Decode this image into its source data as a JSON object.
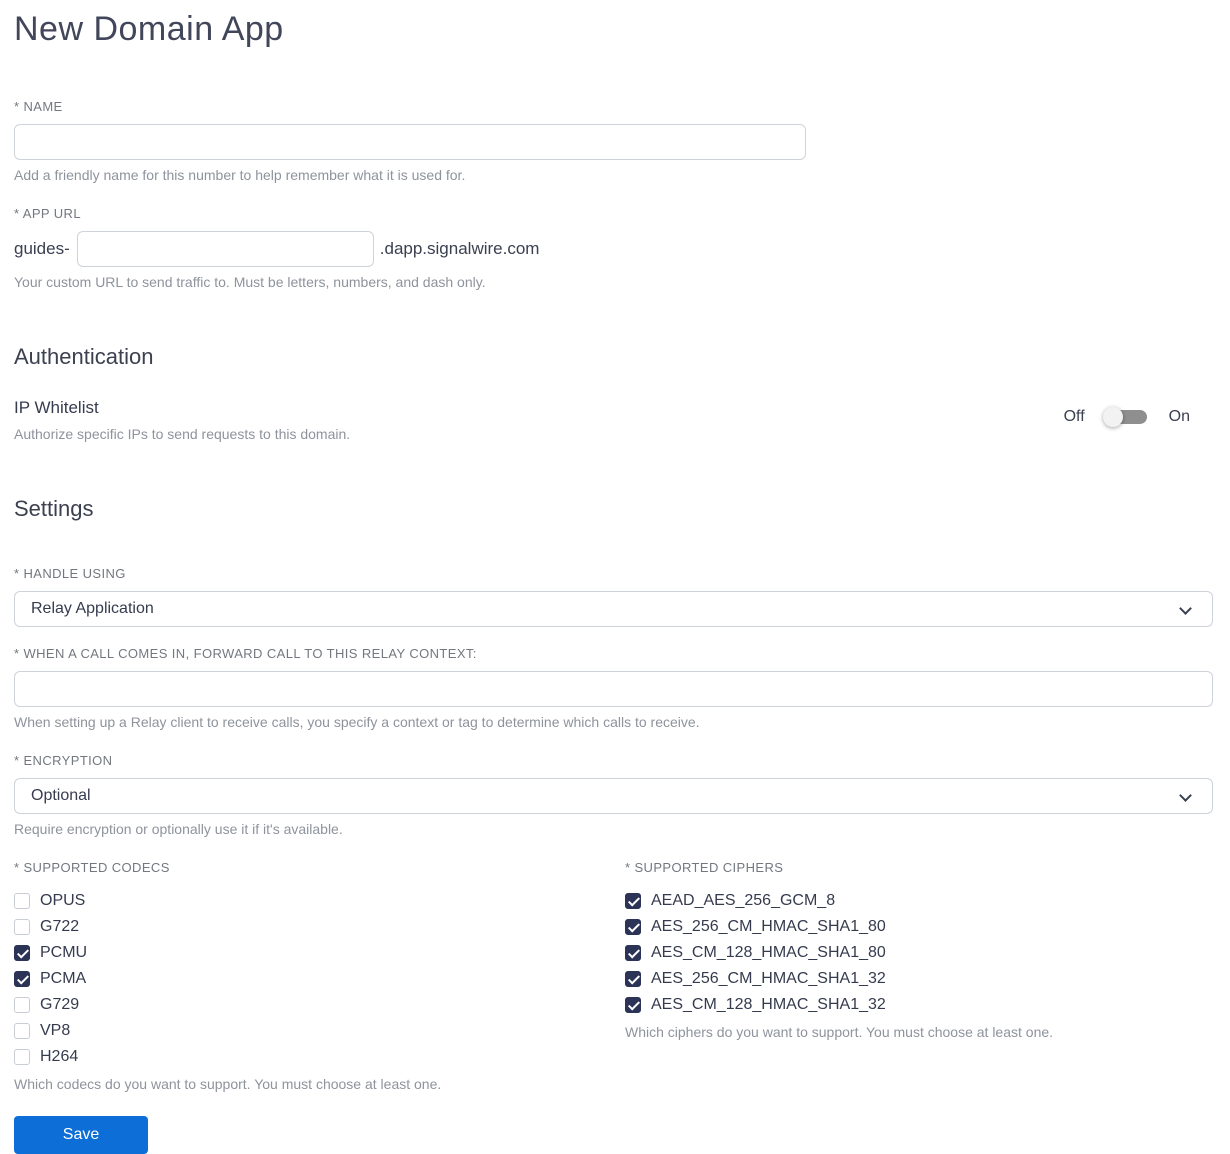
{
  "page": {
    "title": "New Domain App"
  },
  "name_field": {
    "label": "* NAME",
    "value": "",
    "helper": "Add a friendly name for this number to help remember what it is used for."
  },
  "app_url_field": {
    "label": "* APP URL",
    "prefix": "guides-",
    "value": "",
    "suffix": ".dapp.signalwire.com",
    "helper": "Your custom URL to send traffic to. Must be letters, numbers, and dash only."
  },
  "authentication": {
    "heading": "Authentication",
    "ip_whitelist": {
      "label": "IP Whitelist",
      "helper": "Authorize specific IPs to send requests to this domain.",
      "off_label": "Off",
      "on_label": "On",
      "state": "off"
    }
  },
  "settings": {
    "heading": "Settings",
    "handle_using": {
      "label": "* HANDLE USING",
      "value": "Relay Application"
    },
    "relay_context": {
      "label": "* WHEN A CALL COMES IN, FORWARD CALL TO THIS RELAY CONTEXT:",
      "value": "",
      "helper": "When setting up a Relay client to receive calls, you specify a context or tag to determine which calls to receive."
    },
    "encryption": {
      "label": "* ENCRYPTION",
      "value": "Optional",
      "helper": "Require encryption or optionally use it if it's available."
    },
    "codecs": {
      "label": "* SUPPORTED CODECS",
      "options": [
        {
          "label": "OPUS",
          "checked": false
        },
        {
          "label": "G722",
          "checked": false
        },
        {
          "label": "PCMU",
          "checked": true
        },
        {
          "label": "PCMA",
          "checked": true
        },
        {
          "label": "G729",
          "checked": false
        },
        {
          "label": "VP8",
          "checked": false
        },
        {
          "label": "H264",
          "checked": false
        }
      ],
      "helper": "Which codecs do you want to support. You must choose at least one."
    },
    "ciphers": {
      "label": "* SUPPORTED CIPHERS",
      "options": [
        {
          "label": "AEAD_AES_256_GCM_8",
          "checked": true
        },
        {
          "label": "AES_256_CM_HMAC_SHA1_80",
          "checked": true
        },
        {
          "label": "AES_CM_128_HMAC_SHA1_80",
          "checked": true
        },
        {
          "label": "AES_256_CM_HMAC_SHA1_32",
          "checked": true
        },
        {
          "label": "AES_CM_128_HMAC_SHA1_32",
          "checked": true
        }
      ],
      "helper": "Which ciphers do you want to support. You must choose at least one."
    }
  },
  "actions": {
    "save_label": "Save"
  },
  "icons": {
    "chevron_down": "chevron-down-icon",
    "check": "check-icon"
  },
  "colors": {
    "accent_blue": "#0d6ed8",
    "checkbox_navy": "#2b3356",
    "toggle_track_gray": "#8f8f8f"
  }
}
